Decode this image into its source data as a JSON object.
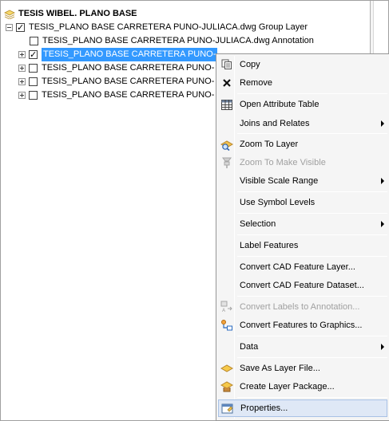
{
  "tree": {
    "root_label": "TESIS WIBEL. PLANO BASE",
    "group_label": "TESIS_PLANO BASE CARRETERA PUNO-JULIACA.dwg Group Layer",
    "children": [
      {
        "label": "TESIS_PLANO BASE CARRETERA PUNO-JULIACA.dwg Annotation",
        "checked": false,
        "expandable": false,
        "selected": false
      },
      {
        "label": "TESIS_PLANO BASE CARRETERA PUNO-",
        "checked": true,
        "expandable": true,
        "selected": true
      },
      {
        "label": "TESIS_PLANO BASE CARRETERA PUNO-",
        "checked": false,
        "expandable": true,
        "selected": false
      },
      {
        "label": "TESIS_PLANO BASE CARRETERA PUNO-",
        "checked": false,
        "expandable": true,
        "selected": false
      },
      {
        "label": "TESIS_PLANO BASE CARRETERA PUNO-",
        "checked": false,
        "expandable": true,
        "selected": false
      }
    ]
  },
  "context_menu": {
    "items": [
      {
        "label": "Copy",
        "icon": "copy-icon",
        "submenu": false,
        "disabled": false
      },
      {
        "label": "Remove",
        "icon": "remove-icon",
        "submenu": false,
        "disabled": false
      },
      {
        "label": "Open Attribute Table",
        "icon": "table-icon",
        "submenu": false,
        "disabled": false
      },
      {
        "label": "Joins and Relates",
        "icon": "",
        "submenu": true,
        "disabled": false
      },
      {
        "label": "Zoom To Layer",
        "icon": "zoom-to-layer-icon",
        "submenu": false,
        "disabled": false
      },
      {
        "label": "Zoom To Make Visible",
        "icon": "zoom-visible-icon",
        "submenu": false,
        "disabled": true
      },
      {
        "label": "Visible Scale Range",
        "icon": "",
        "submenu": true,
        "disabled": false
      },
      {
        "label": "Use Symbol Levels",
        "icon": "",
        "submenu": false,
        "disabled": false
      },
      {
        "label": "Selection",
        "icon": "",
        "submenu": true,
        "disabled": false
      },
      {
        "label": "Label Features",
        "icon": "",
        "submenu": false,
        "disabled": false
      },
      {
        "label": "Convert CAD Feature Layer...",
        "icon": "",
        "submenu": false,
        "disabled": false
      },
      {
        "label": "Convert CAD Feature Dataset...",
        "icon": "",
        "submenu": false,
        "disabled": false
      },
      {
        "label": "Convert Labels to Annotation...",
        "icon": "convert-labels-icon",
        "submenu": false,
        "disabled": true
      },
      {
        "label": "Convert Features to Graphics...",
        "icon": "convert-graphics-icon",
        "submenu": false,
        "disabled": false
      },
      {
        "label": "Data",
        "icon": "",
        "submenu": true,
        "disabled": false
      },
      {
        "label": "Save As Layer File...",
        "icon": "layer-file-icon",
        "submenu": false,
        "disabled": false
      },
      {
        "label": "Create Layer Package...",
        "icon": "layer-package-icon",
        "submenu": false,
        "disabled": false
      },
      {
        "label": "Properties...",
        "icon": "properties-icon",
        "submenu": false,
        "disabled": false,
        "highlighted": true
      }
    ]
  },
  "colors": {
    "selection": "#3399ff",
    "menu_bg": "#f5f5f5",
    "menu_highlight": "#dfe8f6"
  }
}
